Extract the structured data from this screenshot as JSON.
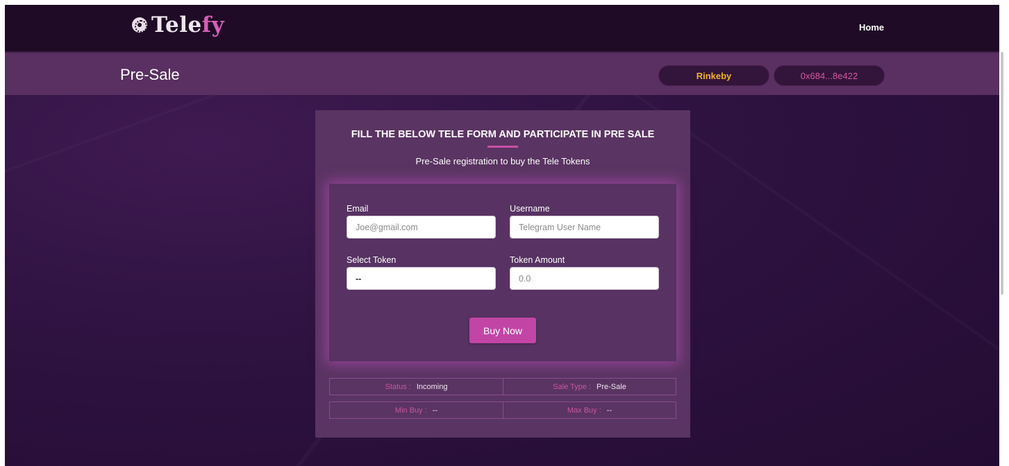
{
  "header": {
    "logo_text_a": "Tele",
    "logo_text_b": "fy",
    "logo_icon": "coin-icon",
    "nav_home": "Home"
  },
  "subheader": {
    "title": "Pre-Sale",
    "network": "Rinkeby",
    "wallet": "0x684...8e422"
  },
  "panel": {
    "heading": "FILL THE BELOW TELE FORM AND PARTICIPATE IN PRE SALE",
    "subheading": "Pre-Sale registration to buy the Tele Tokens"
  },
  "form": {
    "email_label": "Email",
    "email_placeholder": "Joe@gmail.com",
    "username_label": "Username",
    "username_placeholder": "Telegram User Name",
    "token_label": "Select Token",
    "token_value": "--",
    "amount_label": "Token Amount",
    "amount_placeholder": "0.0",
    "buy_label": "Buy Now"
  },
  "info": {
    "status_key": "Status :",
    "status_val": "Incoming",
    "sale_type_key": "Sale Type :",
    "sale_type_val": "Pre-Sale",
    "min_buy_key": "Min Buy :",
    "min_buy_val": "--",
    "max_buy_key": "Max Buy :",
    "max_buy_val": "--"
  },
  "colors": {
    "accent": "#c245a5",
    "network": "#f0b429",
    "wallet": "#d6589e",
    "topbar": "#1f0b26",
    "subbar": "#5a2f62"
  }
}
